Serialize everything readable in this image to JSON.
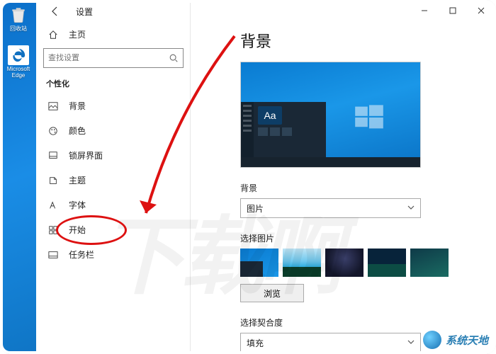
{
  "desktop": {
    "recycle_label": "回收站",
    "edge_label": "Microsoft Edge"
  },
  "window": {
    "app_name": "设置",
    "home_label": "主页",
    "search_placeholder": "查找设置",
    "category": "个性化"
  },
  "sidebar": {
    "items": [
      {
        "label": "背景"
      },
      {
        "label": "颜色"
      },
      {
        "label": "锁屏界面"
      },
      {
        "label": "主题"
      },
      {
        "label": "字体"
      },
      {
        "label": "开始"
      },
      {
        "label": "任务栏"
      }
    ]
  },
  "content": {
    "page_title": "背景",
    "preview_aa": "Aa",
    "bg_label": "背景",
    "bg_select_value": "图片",
    "choose_label": "选择图片",
    "browse_label": "浏览",
    "fit_label": "选择契合度",
    "fit_value": "填充"
  },
  "watermark": {
    "text": "系统天地",
    "bg": "下载啊"
  }
}
